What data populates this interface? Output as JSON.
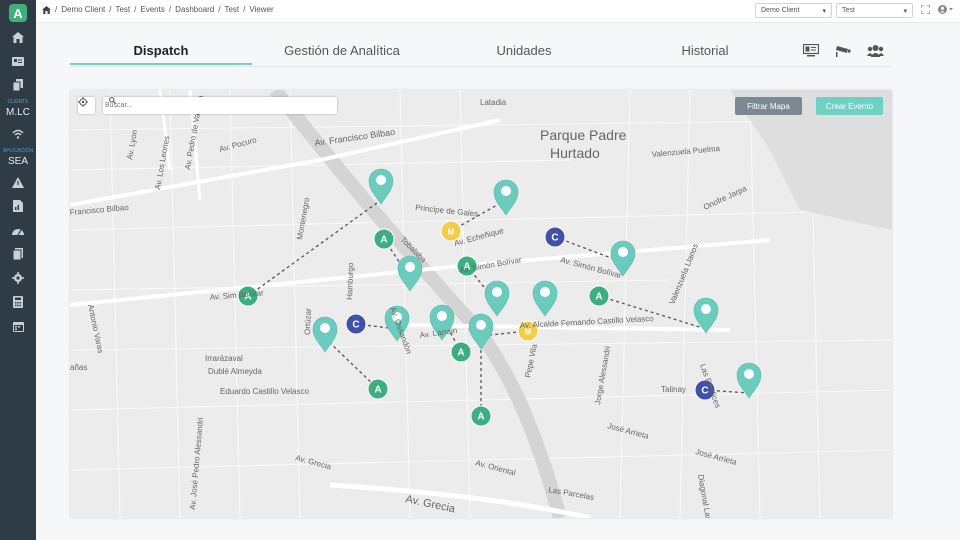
{
  "app": {
    "logo": "A"
  },
  "sidebar": {
    "client_caption": "CLIENTE",
    "client_label": "M.LC",
    "app_caption": "APLICACIÓN",
    "app_label": "SEA"
  },
  "breadcrumb": [
    "Demo Client",
    "Test",
    "Events",
    "Dashboard",
    "Test",
    "Viewer"
  ],
  "header": {
    "client_select": "Demo Client",
    "project_select": "Test"
  },
  "tabs": [
    {
      "label": "Dispatch",
      "active": true
    },
    {
      "label": "Gestión de Analítica",
      "active": false
    },
    {
      "label": "Unidades",
      "active": false
    },
    {
      "label": "Historial",
      "active": false
    }
  ],
  "map": {
    "search_placeholder": "Buscar...",
    "filter_label": "Filtrar Mapa",
    "create_label": "Crear Evento",
    "labels": [
      {
        "text": "Latadia"
      },
      {
        "text": "Parque Padre"
      },
      {
        "text": "Hurtado"
      },
      {
        "text": "Av. Francisco Bilbao"
      },
      {
        "text": "Valenzuela Puelma"
      },
      {
        "text": "Onofre Jarpa"
      },
      {
        "text": "Av. Pocuro"
      },
      {
        "text": "Av. Los Leones"
      },
      {
        "text": "Av. Pedro de Valdivia"
      },
      {
        "text": "Av. Lyon"
      },
      {
        "text": "Francisco Bilbao"
      },
      {
        "text": "Antonio Varas"
      },
      {
        "text": "Montenegro"
      },
      {
        "text": "Principe de Gales"
      },
      {
        "text": "Av. Ossandón"
      },
      {
        "text": "Tobalaba"
      },
      {
        "text": "Av. Simón Bolívar"
      },
      {
        "text": "Av. Sim Bolívar"
      },
      {
        "text": "Av. Simón Bolívar"
      },
      {
        "text": "Av. Alcalde Fernando Castillo Velasco"
      },
      {
        "text": "Valenzuela Llanos"
      },
      {
        "text": "Hamburgo"
      },
      {
        "text": "Ortúzar"
      },
      {
        "text": "Av. Larrain"
      },
      {
        "text": "Pepe Vila"
      },
      {
        "text": "Jorge Alessandri"
      },
      {
        "text": "Las Perdices"
      },
      {
        "text": "Talinay"
      },
      {
        "text": "Irrarázaval"
      },
      {
        "text": "Dublé Almeyda"
      },
      {
        "text": "Eduardo Castillo Velasco"
      },
      {
        "text": "Av. José Pedro Alessandri"
      },
      {
        "text": "Av. Grecia"
      },
      {
        "text": "Av. Oriental"
      },
      {
        "text": "Las Parcelas"
      },
      {
        "text": "Av. Grecia"
      },
      {
        "text": "José Arrieta"
      },
      {
        "text": "José Arrieta"
      },
      {
        "text": "Diagonal Las Torres"
      },
      {
        "text": "Av. Echeñique"
      },
      {
        "text": "añas"
      }
    ],
    "markers": [
      {
        "letter": "A",
        "kind": "ambulance"
      },
      {
        "letter": "A",
        "kind": "ambulance"
      },
      {
        "letter": "A",
        "kind": "ambulance"
      },
      {
        "letter": "A",
        "kind": "ambulance"
      },
      {
        "letter": "A",
        "kind": "ambulance"
      },
      {
        "letter": "A",
        "kind": "ambulance"
      },
      {
        "letter": "A",
        "kind": "ambulance"
      },
      {
        "letter": "C",
        "kind": "carabineros"
      },
      {
        "letter": "C",
        "kind": "carabineros"
      },
      {
        "letter": "C",
        "kind": "carabineros"
      },
      {
        "letter": "M",
        "kind": "municipal"
      },
      {
        "letter": "M",
        "kind": "municipal"
      }
    ],
    "pins": [
      {
        "icon": "fire-icon"
      },
      {
        "icon": "person-icon"
      },
      {
        "icon": "fall-icon"
      },
      {
        "icon": "traffic-light-icon"
      },
      {
        "icon": "dog-icon"
      },
      {
        "icon": "tree-icon"
      },
      {
        "icon": "car-crash-icon"
      },
      {
        "icon": "power-icon"
      },
      {
        "icon": "street-light-icon"
      },
      {
        "icon": "street-light-icon"
      },
      {
        "icon": "flood-icon"
      },
      {
        "icon": "graffiti-icon"
      }
    ],
    "colors": {
      "ambulance": "#3cae7f",
      "carabineros": "#3f51a8",
      "municipal": "#f2cd4a",
      "pin": "#6ccbbf"
    }
  }
}
